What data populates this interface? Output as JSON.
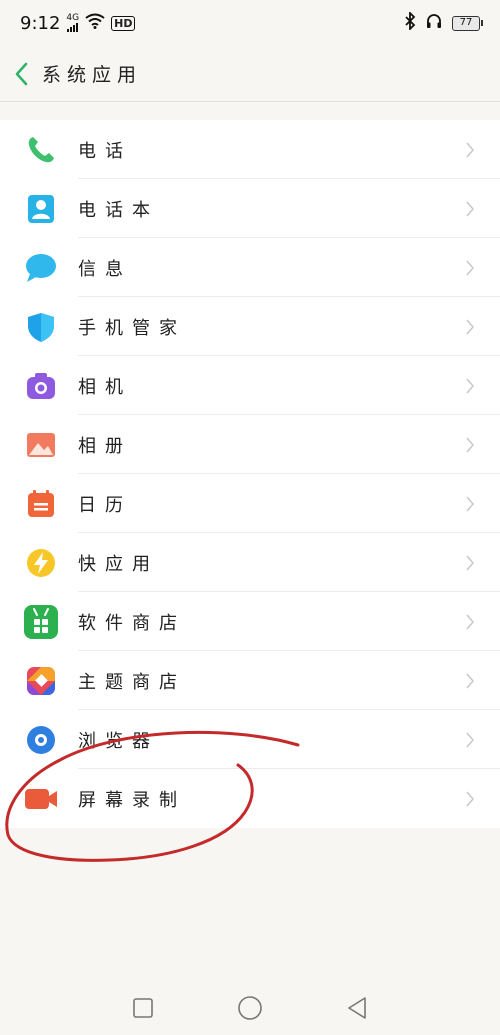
{
  "status_bar": {
    "time": "9:12",
    "signal_label": "4G",
    "hd_label": "HD",
    "battery": "77"
  },
  "header": {
    "title": "系统应用"
  },
  "apps": [
    {
      "label": "电话",
      "icon": "phone-icon"
    },
    {
      "label": "电话本",
      "icon": "contacts-icon"
    },
    {
      "label": "信息",
      "icon": "messages-icon"
    },
    {
      "label": "手机管家",
      "icon": "phone-manager-icon"
    },
    {
      "label": "相机",
      "icon": "camera-icon"
    },
    {
      "label": "相册",
      "icon": "gallery-icon"
    },
    {
      "label": "日历",
      "icon": "calendar-icon"
    },
    {
      "label": "快应用",
      "icon": "quick-app-icon"
    },
    {
      "label": "软件商店",
      "icon": "app-store-icon"
    },
    {
      "label": "主题商店",
      "icon": "theme-store-icon"
    },
    {
      "label": "浏览器",
      "icon": "browser-icon"
    },
    {
      "label": "屏幕录制",
      "icon": "screen-recorder-icon"
    }
  ],
  "colors": {
    "accent": "#2fb36b",
    "annotation": "#c42a2a"
  }
}
